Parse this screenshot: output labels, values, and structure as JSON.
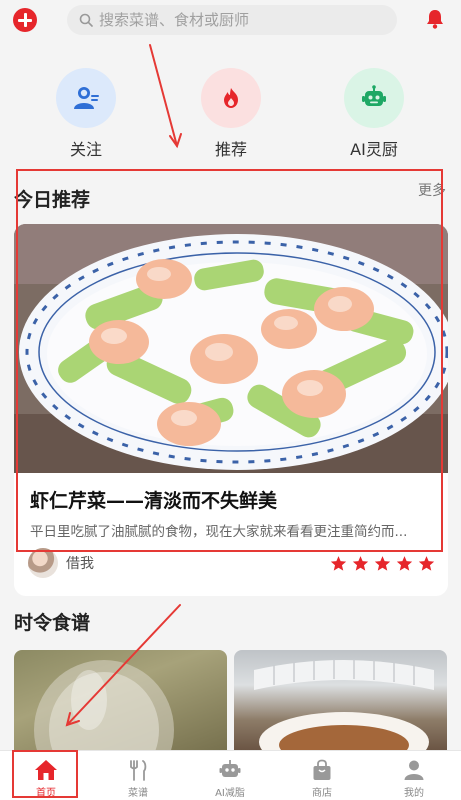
{
  "search": {
    "placeholder": "搜索菜谱、食材或厨师"
  },
  "quick_entries": [
    {
      "label": "关注",
      "icon": "user-follow-icon",
      "bg": "#dce9fb"
    },
    {
      "label": "推荐",
      "icon": "recommend-flame-icon",
      "bg": "#fbe0e0"
    },
    {
      "label": "AI灵厨",
      "icon": "robot-icon",
      "bg": "#daf4e6"
    }
  ],
  "today": {
    "title": "今日推荐",
    "more": "更多",
    "card": {
      "title": "虾仁芹菜——清淡而不失鲜美",
      "desc": "平日里吃腻了油腻腻的食物，现在大家就来看看更注重简约而...",
      "author": "借我",
      "rating": 5
    }
  },
  "seasonal": {
    "title": "时令食谱"
  },
  "bottom_nav": [
    {
      "label": "首页",
      "icon": "home-icon",
      "active": true
    },
    {
      "label": "菜谱",
      "icon": "fork-knife-icon",
      "active": false
    },
    {
      "label": "AI减脂",
      "icon": "robot-icon",
      "active": false
    },
    {
      "label": "商店",
      "icon": "shopping-bag-icon",
      "active": false
    },
    {
      "label": "我的",
      "icon": "profile-icon",
      "active": false
    }
  ],
  "colors": {
    "accent": "#e6262b",
    "annotation": "#e53935",
    "page_bg": "#f4f4f4"
  }
}
